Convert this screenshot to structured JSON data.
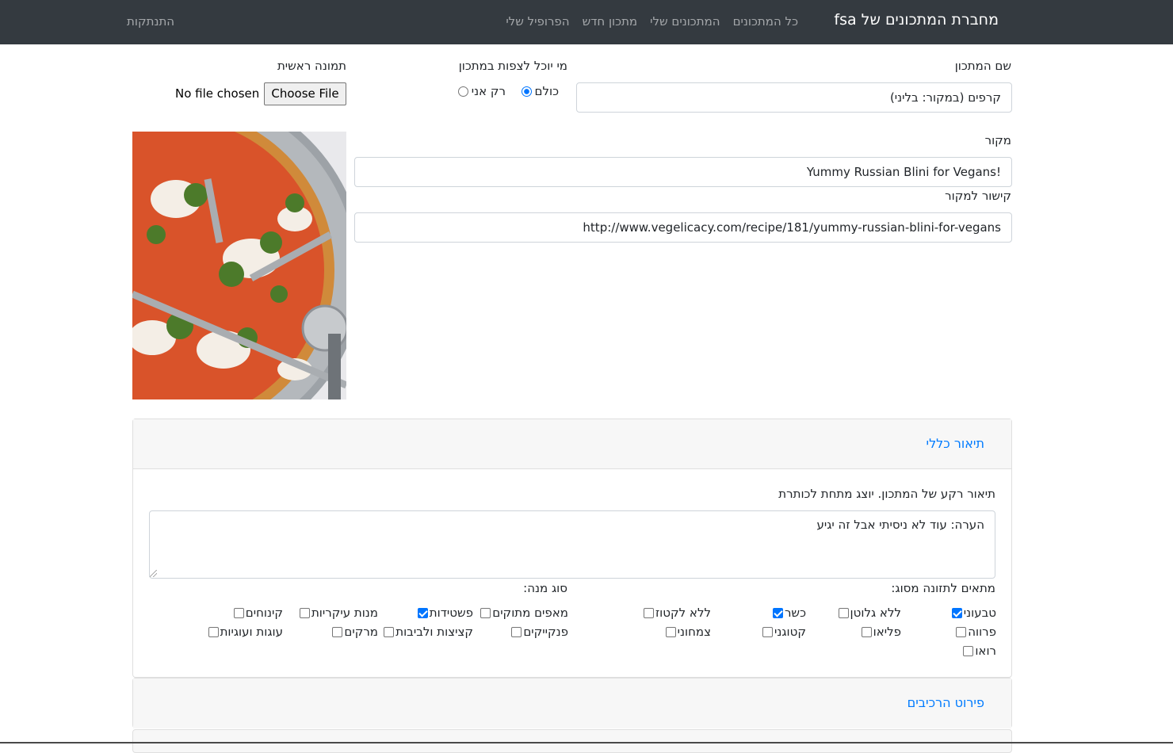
{
  "navbar": {
    "brand": "מחברת המתכונים של fsa",
    "links": [
      "הפרופיל שלי",
      "מתכון חדש",
      "המתכונים שלי",
      "כל המתכונים"
    ],
    "logout": "התנתקות"
  },
  "form": {
    "recipe_name_label": "שם המתכון",
    "recipe_name_value": "קרפים (במקור: בליני)",
    "visibility_label": "מי יוכל לצפות במתכון",
    "visibility_options": [
      "כולם",
      "רק אני"
    ],
    "visibility_selected": "כולם",
    "main_image_label": "תמונה ראשית",
    "file_button": "Choose File",
    "file_status": "No file chosen",
    "source_label": "מקור",
    "source_value": "Yummy Russian Blini for Vegans!",
    "source_link_label": "קישור למקור",
    "source_link_value": "http://www.vegelicacy.com/recipe/181/yummy-russian-blini-for-vegans"
  },
  "general_card": {
    "title": "תיאור כללי",
    "description_label": "תיאור רקע של המתכון. יוצג מתחת לכותרת",
    "description_value": "הערה: עוד לא ניסיתי אבל זה יגיע",
    "diet_label": "מתאים לתזונה מסוג:",
    "diets": [
      {
        "label": "טבעוני",
        "checked": true
      },
      {
        "label": "ללא גלוטן",
        "checked": false
      },
      {
        "label": "כשר",
        "checked": true
      },
      {
        "label": "ללא לקטוז",
        "checked": false
      },
      {
        "label": "פרווה",
        "checked": false
      },
      {
        "label": "פליאו",
        "checked": false
      },
      {
        "label": "קטוגני",
        "checked": false
      },
      {
        "label": "צמחוני",
        "checked": false
      },
      {
        "label": "רואו",
        "checked": false
      }
    ],
    "dish_label": "סוג מנה:",
    "dishes": [
      {
        "label": "מאפים מתוקים",
        "checked": false
      },
      {
        "label": "פשטידות",
        "checked": true
      },
      {
        "label": "מנות עיקריות",
        "checked": false
      },
      {
        "label": "קינוחים",
        "checked": false
      },
      {
        "label": "פנקייקים",
        "checked": false
      },
      {
        "label": "קציצות ולביבות",
        "checked": false
      },
      {
        "label": "מרקים",
        "checked": false
      },
      {
        "label": "עוגות ועוגיות",
        "checked": false
      }
    ]
  },
  "ingredients_card": {
    "title": "פירוט הרכיבים"
  }
}
